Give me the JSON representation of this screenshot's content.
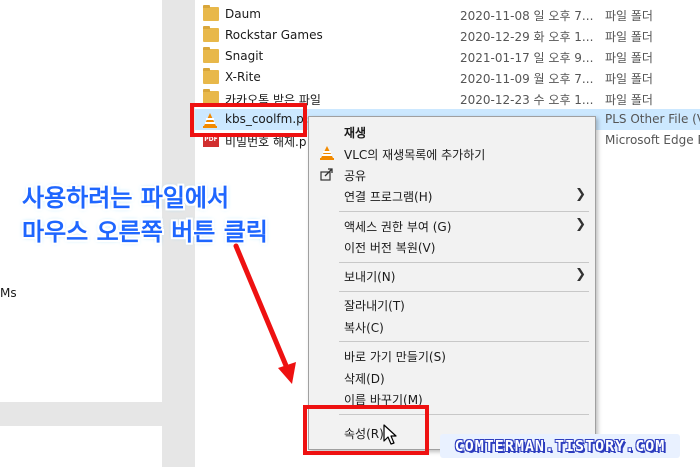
{
  "nav": {
    "partial_label": "Ms"
  },
  "files": [
    {
      "name": "Daum",
      "date": "2020-11-08 일 오후 7...",
      "type": "파일 폴더",
      "icon": "folder-icon"
    },
    {
      "name": "Rockstar Games",
      "date": "2020-12-29 화 오후 1...",
      "type": "파일 폴더",
      "icon": "folder-icon"
    },
    {
      "name": "Snagit",
      "date": "2021-01-17 일 오후 9...",
      "type": "파일 폴더",
      "icon": "folder-icon"
    },
    {
      "name": "X-Rite",
      "date": "2020-11-09 월 오후 7...",
      "type": "파일 폴더",
      "icon": "folder-icon"
    },
    {
      "name": "카카오톡 받은 파일",
      "date": "2020-12-23 수 오후 1...",
      "type": "파일 폴더",
      "icon": "folder-icon"
    },
    {
      "name": "kbs_coolfm.pls",
      "date": "",
      "type": "PLS Other File (V...",
      "icon": "vlc-icon",
      "selected": true
    },
    {
      "name": "비밀번호 해제.p",
      "date": "",
      "type": "Microsoft Edge P...",
      "icon": "pdf-icon"
    }
  ],
  "context_menu": {
    "items": [
      {
        "label": "재생",
        "bold": true,
        "icon": ""
      },
      {
        "label": "VLC의 재생목록에 추가하기",
        "icon": "vlc-icon"
      },
      {
        "label": "공유",
        "icon": "share-icon"
      },
      {
        "label": "연결 프로그램(H)",
        "submenu": true
      },
      {
        "label": "액세스 권한 부여 (G)",
        "submenu": true
      },
      {
        "label": "이전 버전 복원(V)"
      },
      {
        "label": "보내기(N)",
        "submenu": true
      },
      {
        "label": "잘라내기(T)"
      },
      {
        "label": "복사(C)"
      },
      {
        "label": "바로 가기 만들기(S)"
      },
      {
        "label": "삭제(D)"
      },
      {
        "label": "이름 바꾸기(M)"
      },
      {
        "label": "속성(R)"
      }
    ],
    "submenu_arrow": "❯"
  },
  "annotation": {
    "line1": "사용하려는 파일에서",
    "line2": "마우스 오른쪽 버튼 클릭",
    "color": "#1e66ff"
  },
  "highlight_color": "#ee1111",
  "watermark": "COMTERMAN.TISTORY.COM"
}
